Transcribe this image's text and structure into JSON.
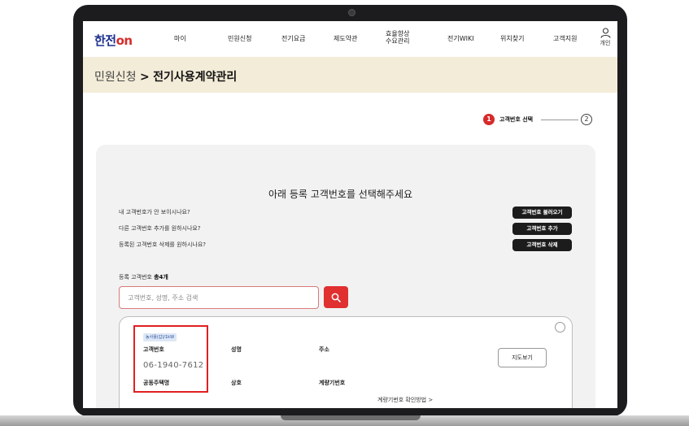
{
  "header": {
    "logo_main": "한전",
    "logo_on": "on",
    "nav": [
      "마이",
      "민원신청",
      "전기요금",
      "제도약관",
      "효율향상\n수요관리",
      "전기WIKI",
      "위치찾기",
      "고객지원"
    ],
    "login_label": "개인"
  },
  "breadcrumb": {
    "parent": "민원신청",
    "separator": ">",
    "current": "전기사용계약관리"
  },
  "stepper": {
    "step1_number": "1",
    "step1_label": "고객번호 선택",
    "step2_number": "2"
  },
  "main": {
    "headline": "아래 등록 고객번호를 선택해주세요",
    "questions": [
      "내 고객번호가 안 보이시나요?",
      "다른 고객번호 추가를 원하시나요?",
      "등록된 고객번호 삭제를 원하시나요?"
    ],
    "buttons": [
      "고객번호 불러오기",
      "고객번호 추가",
      "고객번호 삭제"
    ],
    "registered_label": "등록 고객번호",
    "registered_count": "총4개",
    "search_placeholder": "고객번호, 성명, 주소 검색"
  },
  "card": {
    "tag": "농사용(갑)/1kW",
    "customer_no_label": "고객번호",
    "customer_no": "06-1940-7612",
    "name_label": "성명",
    "address_label": "주소",
    "shared_label": "공동주택명",
    "shop_label": "상호",
    "meter_label": "계량기번호",
    "map_button": "지도보기",
    "meter_link": "계량기번호 확인방법 >"
  },
  "colors": {
    "accent": "#e0302f",
    "brand_blue": "#1b2f8f",
    "band": "#f3ecd8",
    "panel": "#f2f2f2"
  }
}
